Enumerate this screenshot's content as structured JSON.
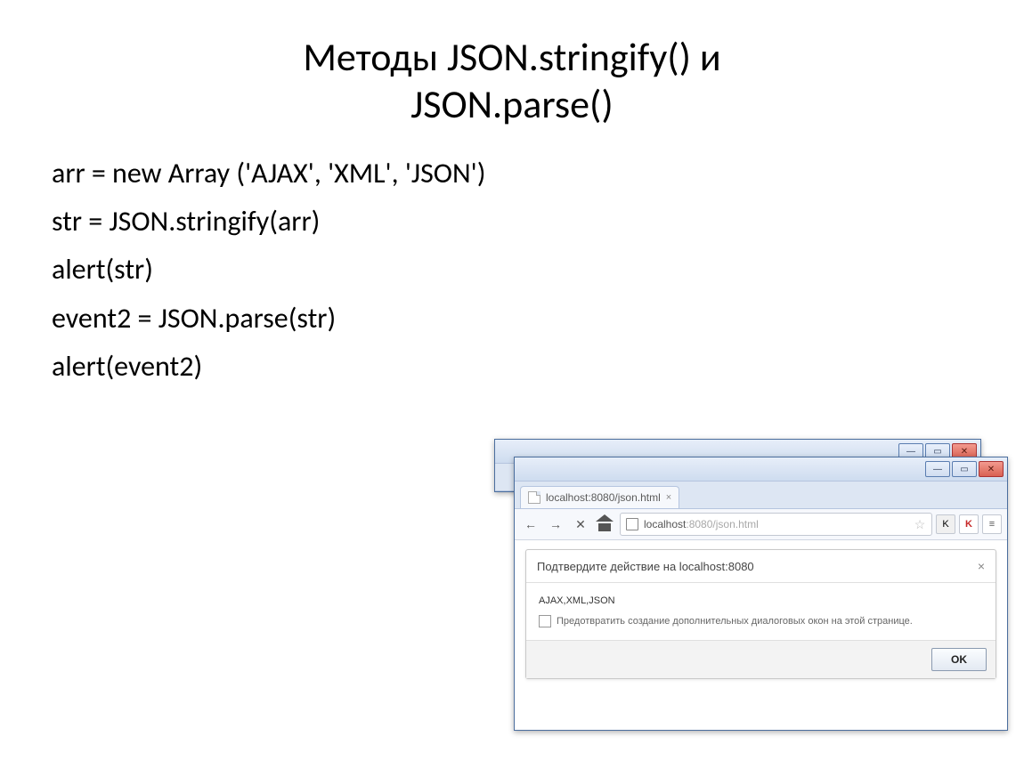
{
  "title_line1": "Методы JSON.stringify() и",
  "title_line2": "JSON.parse()",
  "code": {
    "l1": "arr = new Array ('AJAX', 'XML', 'JSON')",
    "l2": "str = JSON.stringify(arr)",
    "l3": "alert(str)",
    "l4": "event2 = JSON.parse(str)",
    "l5": "alert(event2)"
  },
  "browser": {
    "tab_title": "localhost:8080/json.html",
    "url_host": "localhost",
    "url_port_path": ":8080/json.html",
    "win_min": "—",
    "win_max": "▭",
    "win_close": "✕",
    "back": "←",
    "forward": "→",
    "reload": "✕",
    "star": "☆",
    "ext_k": "K",
    "ext_kasp": "K",
    "ext_menu": "≡",
    "tab_close": "×"
  },
  "dialog": {
    "header": "Подтвердите действие на localhost:8080",
    "close": "×",
    "message": "AJAX,XML,JSON",
    "checkbox": "Предотвратить создание дополнительных диалоговых окон на этой странице.",
    "ok": "OK"
  }
}
